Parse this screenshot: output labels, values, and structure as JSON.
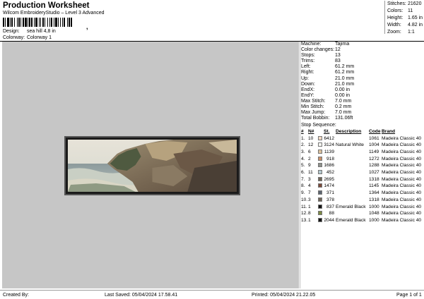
{
  "header": {
    "title": "Production Worksheet",
    "subtitle": "Wilcom EmbroideryStudio – Level 3 Advanced",
    "barcode_tail": ",",
    "design_label": "Design:",
    "design_value": "sea hill 4,8 in",
    "colorway_label": "Colorway:",
    "colorway_value": "Colorway 1"
  },
  "top_stats": [
    {
      "label": "Stitches:",
      "value": "21620"
    },
    {
      "label": "Colors:",
      "value": "11"
    },
    {
      "label": "Height:",
      "value": "1.65 in"
    },
    {
      "label": "Width:",
      "value": "4.82 in"
    },
    {
      "label": "Zoom:",
      "value": "1:1"
    }
  ],
  "machine_stats": [
    {
      "label": "Machine:",
      "value": "Tajima"
    },
    {
      "label": "Color changes:",
      "value": "12"
    },
    {
      "label": "Stops:",
      "value": "13"
    },
    {
      "label": "Trims:",
      "value": "83"
    },
    {
      "label": "Left:",
      "value": "61.2 mm"
    },
    {
      "label": "Right:",
      "value": "61.2 mm"
    },
    {
      "label": "Up:",
      "value": "21.0 mm"
    },
    {
      "label": "Down:",
      "value": "21.0 mm"
    },
    {
      "label": "EndX:",
      "value": "0.00 in"
    },
    {
      "label": "EndY:",
      "value": "0.00 in"
    },
    {
      "label": "Max Stitch:",
      "value": "7.0 mm"
    },
    {
      "label": "Min Stitch:",
      "value": "0.2 mm"
    },
    {
      "label": "Max Jump:",
      "value": "7.0 mm"
    },
    {
      "label": "Total Bobbin:",
      "value": "131.06ft"
    }
  ],
  "stop_sequence": {
    "title": "Stop Sequence:",
    "headers": [
      "#",
      "N#",
      "",
      "St.",
      "Description",
      "Code",
      "Brand"
    ],
    "rows": [
      {
        "idx": "1.",
        "n": "10",
        "color": "#f1d9c4",
        "st": "6412",
        "desc": "",
        "code": "1061",
        "brand": "Madeira Classic 40"
      },
      {
        "idx": "2.",
        "n": "12",
        "color": "#f4f4f0",
        "st": "3124",
        "desc": "Natural White",
        "code": "1004",
        "brand": "Madeira Classic 40"
      },
      {
        "idx": "3.",
        "n": "6",
        "color": "#dcc29e",
        "st": "1139",
        "desc": "",
        "code": "1149",
        "brand": "Madeira Classic 40"
      },
      {
        "idx": "4.",
        "n": "2",
        "color": "#c9916a",
        "st": "918",
        "desc": "",
        "code": "1272",
        "brand": "Madeira Classic 40"
      },
      {
        "idx": "5.",
        "n": "9",
        "color": "#8f928c",
        "st": "1686",
        "desc": "",
        "code": "1288",
        "brand": "Madeira Classic 40"
      },
      {
        "idx": "6.",
        "n": "11",
        "color": "#b5c9ce",
        "st": "452",
        "desc": "",
        "code": "1027",
        "brand": "Madeira Classic 40"
      },
      {
        "idx": "7.",
        "n": "3",
        "color": "#6e6557",
        "st": "2695",
        "desc": "",
        "code": "1318",
        "brand": "Madeira Classic 40"
      },
      {
        "idx": "8.",
        "n": "4",
        "color": "#7a4a3a",
        "st": "1474",
        "desc": "",
        "code": "1145",
        "brand": "Madeira Classic 40"
      },
      {
        "idx": "9.",
        "n": "7",
        "color": "#5d6670",
        "st": "371",
        "desc": "",
        "code": "1364",
        "brand": "Madeira Classic 40"
      },
      {
        "idx": "10.",
        "n": "3",
        "color": "#6e6557",
        "st": "378",
        "desc": "",
        "code": "1318",
        "brand": "Madeira Classic 40"
      },
      {
        "idx": "11.",
        "n": "1",
        "color": "#141414",
        "st": "837",
        "desc": "Emerald Black",
        "code": "1000",
        "brand": "Madeira Classic 40"
      },
      {
        "idx": "12.",
        "n": "8",
        "color": "#7d8a45",
        "st": "88",
        "desc": "",
        "code": "1048",
        "brand": "Madeira Classic 40"
      },
      {
        "idx": "13.",
        "n": "1",
        "color": "#141414",
        "st": "2044",
        "desc": "Emerald Black",
        "code": "1000",
        "brand": "Madeira Classic 40"
      }
    ]
  },
  "footer": {
    "created_by": "Created By:",
    "last_saved": "Last Saved: 05/04/2024 17.58.41",
    "printed": "Printed: 05/04/2024 21.22.05",
    "page": "Page 1 of 1"
  }
}
